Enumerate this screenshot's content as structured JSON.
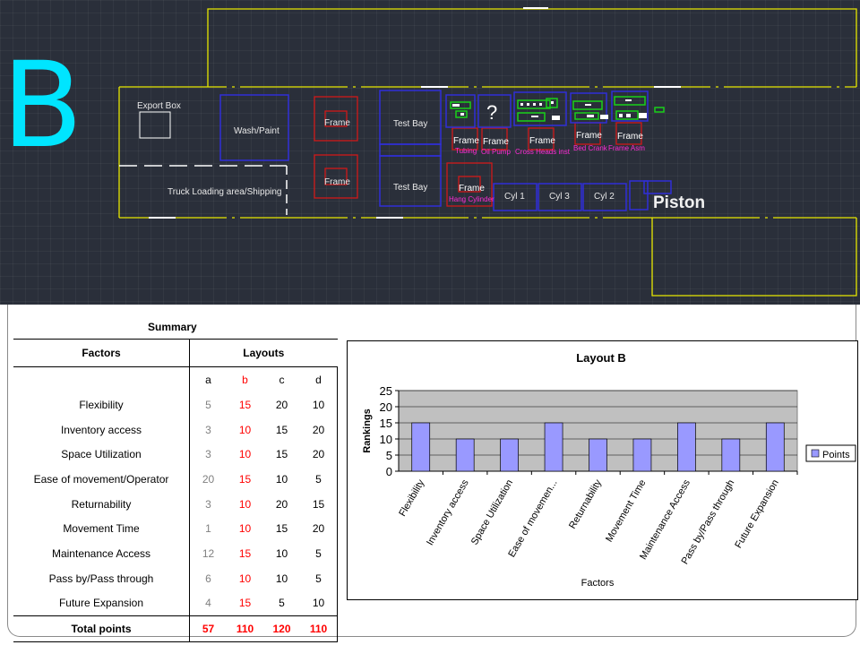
{
  "layout_label": "B",
  "cad": {
    "export_box": "Export Box",
    "wash_paint": "Wash/Paint",
    "truck_loading": "Truck Loading area/Shipping",
    "frame": "Frame",
    "test_bay": "Test Bay",
    "question_mark": "?",
    "tubing": "Tubing",
    "oil_pump": "Oil Pump",
    "cross_heads": "Cross Heads inst",
    "bed_crank": "Bed Crank",
    "frame_asm": "Frame Asm",
    "hang_cylinder": "Hang Cylinder",
    "cyl1": "Cyl 1",
    "cyl3": "Cyl 3",
    "cyl2": "Cyl 2",
    "piston": "Piston"
  },
  "summary": {
    "title": "Summary",
    "col_factors": "Factors",
    "col_layouts": "Layouts",
    "layout_letters": [
      "a",
      "b",
      "c",
      "d"
    ],
    "rows": [
      {
        "factor": "Flexibility",
        "values": [
          5,
          15,
          20,
          10
        ]
      },
      {
        "factor": "Inventory access",
        "values": [
          3,
          10,
          15,
          20
        ]
      },
      {
        "factor": "Space Utilization",
        "values": [
          3,
          10,
          15,
          20
        ]
      },
      {
        "factor": "Ease of movement/Operator",
        "values": [
          20,
          15,
          10,
          5
        ]
      },
      {
        "factor": "Returnability",
        "values": [
          3,
          10,
          20,
          15
        ]
      },
      {
        "factor": "Movement Time",
        "values": [
          1,
          10,
          15,
          20
        ]
      },
      {
        "factor": "Maintenance Access",
        "values": [
          12,
          15,
          10,
          5
        ]
      },
      {
        "factor": "Pass by/Pass through",
        "values": [
          6,
          10,
          10,
          5
        ]
      },
      {
        "factor": "Future Expansion",
        "values": [
          4,
          15,
          5,
          10
        ]
      }
    ],
    "total_label": "Total points",
    "totals": [
      57,
      110,
      120,
      110
    ],
    "colors": {
      "gray": "#808080",
      "red": "#ff0000"
    }
  },
  "chart_data": {
    "type": "bar",
    "title": "Layout B",
    "xlabel": "Factors",
    "ylabel": "Rankings",
    "categories": [
      "Flexibility",
      "Inventory access",
      "Space Utilization",
      "Ease of movemen...",
      "Returnability",
      "Movement Time",
      "Maintenance Access",
      "Pass by/Pass through",
      "Future Expansion"
    ],
    "series": [
      {
        "name": "Points",
        "values": [
          15,
          10,
          10,
          15,
          10,
          10,
          15,
          10,
          15
        ]
      }
    ],
    "ylim": [
      0,
      25
    ],
    "yticks": [
      0,
      5,
      10,
      15,
      20,
      25
    ],
    "grid": true,
    "legend": "right",
    "colors": {
      "bar": "#9999ff",
      "plot_bg": "#c0c0c0"
    }
  }
}
